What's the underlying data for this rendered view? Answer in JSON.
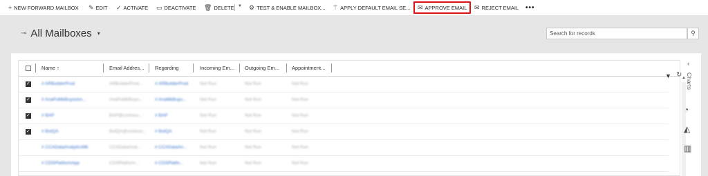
{
  "toolbar": {
    "new_forward_mailbox": "NEW FORWARD MAILBOX",
    "edit": "EDIT",
    "activate": "ACTIVATE",
    "deactivate": "DEACTIVATE",
    "delete": "DELETE",
    "test_enable": "TEST & ENABLE MAILBOX...",
    "apply_default_email": "APPLY DEFAULT EMAIL SE...",
    "approve_email": "APPROVE EMAIL",
    "reject_email": "REJECT EMAIL",
    "more": "•••",
    "highlight_color": "#d11111"
  },
  "view": {
    "title": "All Mailboxes"
  },
  "search": {
    "placeholder": "Search for records"
  },
  "grid": {
    "columns": [
      "Name ↑",
      "Email Addres...",
      "Regarding",
      "Incoming Em...",
      "Outgoing Em...",
      "Appointment..."
    ],
    "rows": [
      {
        "checked": true,
        "name": "# ARBuilderProd",
        "email": "ARBuilderProd...",
        "regarding": "# ARBuilderProd",
        "incoming": "Not Run",
        "outgoing": "Not Run",
        "appointment": "Not Run"
      },
      {
        "checked": true,
        "name": "# AnaPoMkBuyoutm...",
        "email": "AnaPoMkBuyo...",
        "regarding": "# AnaMkBuyo...",
        "incoming": "Not Run",
        "outgoing": "Not Run",
        "appointment": "Not Run"
      },
      {
        "checked": true,
        "name": "# BAP",
        "email": "BAP@contoso...",
        "regarding": "# BAP",
        "incoming": "Not Run",
        "outgoing": "Not Run",
        "appointment": "Not Run"
      },
      {
        "checked": true,
        "name": "# BotQA",
        "email": "BotQA@contoso...",
        "regarding": "# BotQA",
        "incoming": "Not Run",
        "outgoing": "Not Run",
        "appointment": "Not Run"
      },
      {
        "checked": false,
        "name": "# CCADataAnalyticsMk",
        "email": "CCADataAnal...",
        "regarding": "# CCADataAn...",
        "incoming": "Not Run",
        "outgoing": "Not Run",
        "appointment": "Not Run"
      },
      {
        "checked": false,
        "name": "# CDSPlatformApp",
        "email": "CDSPlatform...",
        "regarding": "# CDSPlatfo...",
        "incoming": "Not Run",
        "outgoing": "Not Run",
        "appointment": "Not Run"
      }
    ]
  },
  "charts": {
    "label": "Charts"
  }
}
